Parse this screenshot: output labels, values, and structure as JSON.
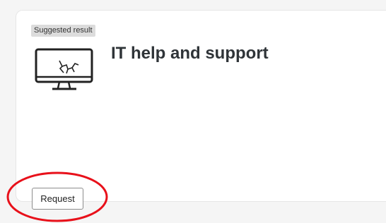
{
  "card": {
    "badge": "Suggested result",
    "title": "IT help and support",
    "icon": "broken-monitor-icon",
    "request_label": "Request"
  },
  "colors": {
    "annotation": "#e8101a",
    "title": "#2f3438",
    "badge_bg": "#dcdcdc"
  }
}
